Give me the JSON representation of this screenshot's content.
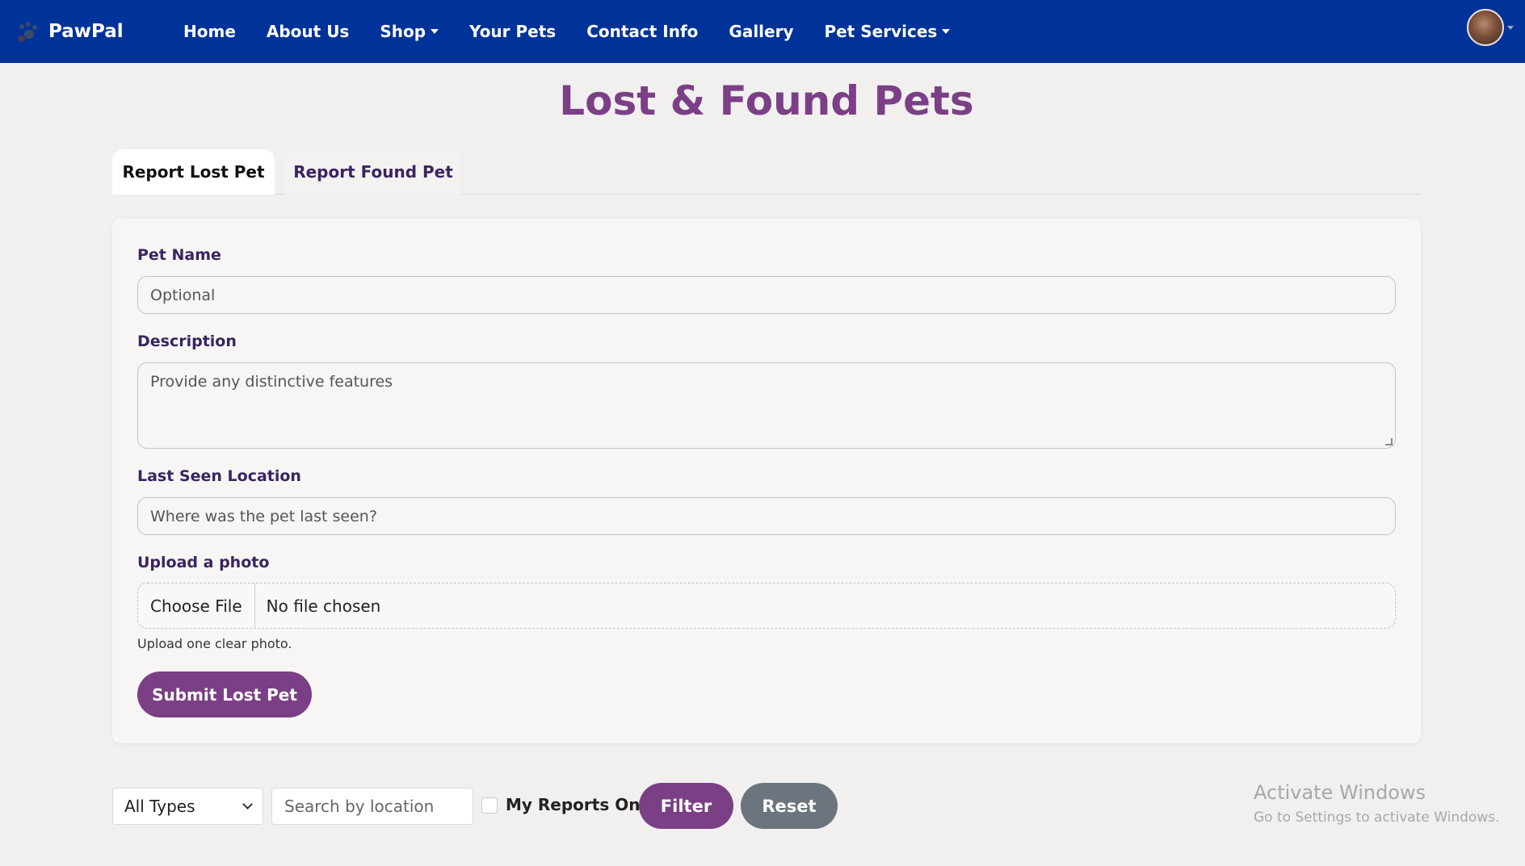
{
  "navbar": {
    "brand": "PawPal",
    "links": [
      {
        "label": "Home"
      },
      {
        "label": "About Us"
      },
      {
        "label": "Shop"
      },
      {
        "label": "Your Pets"
      },
      {
        "label": "Contact Info"
      },
      {
        "label": "Gallery"
      },
      {
        "label": "Pet Services"
      }
    ],
    "background_color": "#003399"
  },
  "page": {
    "title": "Lost & Found Pets",
    "title_color": "#7b3f86"
  },
  "tabs": [
    {
      "label": "Report Lost Pet",
      "active": true
    },
    {
      "label": "Report Found Pet",
      "active": false
    }
  ],
  "form": {
    "pet_name": {
      "label": "Pet Name",
      "placeholder": "Optional"
    },
    "description": {
      "label": "Description",
      "placeholder": "Provide any distinctive features"
    },
    "last_seen": {
      "label": "Last Seen Location",
      "placeholder": "Where was the pet last seen?"
    },
    "photo": {
      "label": "Upload a photo",
      "choose_button": "Choose File",
      "file_status": "No file chosen",
      "helper": "Upload one clear photo."
    },
    "submit_label": "Submit Lost Pet"
  },
  "filters": {
    "type_select": "All Types",
    "search_placeholder": "Search by location",
    "my_reports_label": "My Reports Only",
    "my_reports_checked": false,
    "filter_label": "Filter",
    "reset_label": "Reset"
  },
  "watermark": {
    "title": "Activate Windows",
    "subtitle": "Go to Settings to activate Windows."
  }
}
